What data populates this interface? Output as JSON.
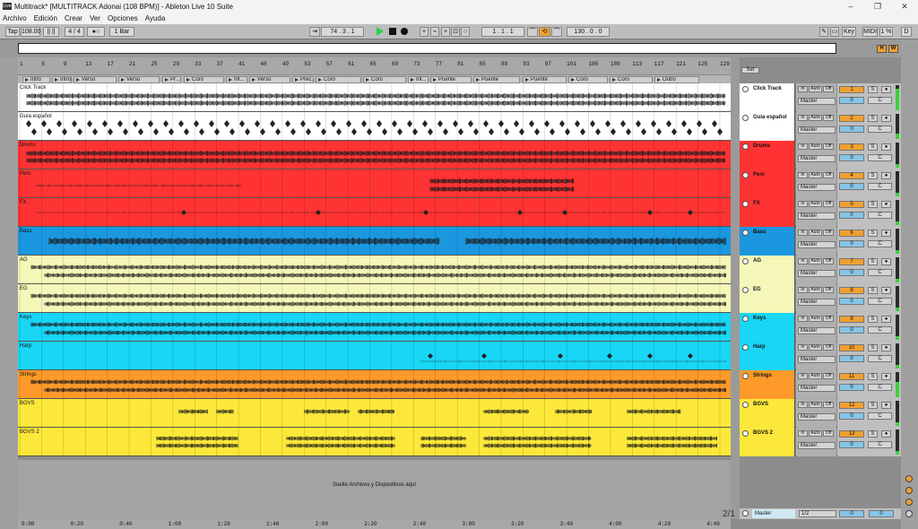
{
  "window": {
    "title": "Multitrack*  [MULTITRACK Adonai (108 BPM)] - Ableton Live 10 Suite",
    "app_icon": "Live"
  },
  "menu": [
    "Archivo",
    "Edición",
    "Crear",
    "Ver",
    "Opciones",
    "Ayuda"
  ],
  "control_bar": {
    "tap": "Tap",
    "tempo": "108.00",
    "nudge": "|| ||",
    "signature": "4 / 4",
    "metronome": "●○",
    "quantize": "1 Bar",
    "follow": "⇥",
    "position": "74 .   3 .   1",
    "loop_start": "1 .   1 .   1",
    "loop_length": "130 .   0 .   0",
    "key": "Key",
    "midi": "MIDI",
    "cpu": "1 %",
    "d": "D"
  },
  "overview": {
    "h_button": "H",
    "w_button": "W"
  },
  "ruler_bars": [
    "1",
    "5",
    "9",
    "13",
    "17",
    "21",
    "25",
    "29",
    "33",
    "37",
    "41",
    "45",
    "49",
    "53",
    "57",
    "61",
    "65",
    "69",
    "73",
    "77",
    "81",
    "85",
    "89",
    "93",
    "97",
    "101",
    "105",
    "109",
    "113",
    "117",
    "121",
    "125",
    "129"
  ],
  "locators": [
    "Intro",
    "Intro",
    "Verso",
    "Verso",
    "Pr...",
    "Coro",
    "Int...",
    "Verso",
    "Prec...",
    "Coro",
    "Coro",
    "Int...",
    "Puente",
    "Puente",
    "Puente",
    "Coro",
    "Coro",
    "Outro"
  ],
  "tracks": [
    {
      "name": "Click Track",
      "color": "#ffffff",
      "num": "1",
      "output": "Master",
      "vol": "0",
      "pattern": "dense"
    },
    {
      "name": "Guía español",
      "color": "#ffffff",
      "num": "2",
      "output": "Master",
      "vol": "0",
      "pattern": "spiky"
    },
    {
      "name": "Drums",
      "color": "#ff3333",
      "num": "3",
      "output": "Master",
      "vol": "0",
      "pattern": "dense"
    },
    {
      "name": "Perc",
      "color": "#ff3333",
      "num": "4",
      "output": "Master",
      "vol": "0",
      "pattern": "partial"
    },
    {
      "name": "FX",
      "color": "#ff3333",
      "num": "5",
      "output": "Master",
      "vol": "0",
      "pattern": "sparse"
    },
    {
      "name": "Bass",
      "color": "#1b97e0",
      "num": "6",
      "output": "Master",
      "vol": "0",
      "pattern": "wide"
    },
    {
      "name": "AG",
      "color": "#f4f7b8",
      "num": "7",
      "output": "Master",
      "vol": "0",
      "pattern": "double"
    },
    {
      "name": "EG",
      "color": "#f4f7b8",
      "num": "8",
      "output": "Master",
      "vol": "0",
      "pattern": "double"
    },
    {
      "name": "Keys",
      "color": "#19d6f5",
      "num": "9",
      "output": "Master",
      "vol": "0",
      "pattern": "double"
    },
    {
      "name": "Harp",
      "color": "#19d6f5",
      "num": "10",
      "output": "Master",
      "vol": "0",
      "pattern": "sparse2"
    },
    {
      "name": "Strings",
      "color": "#fd9a2a",
      "num": "11",
      "output": "Master",
      "vol": "0",
      "pattern": "double"
    },
    {
      "name": "BGVS",
      "color": "#fbe83a",
      "num": "12",
      "output": "Master",
      "vol": "0",
      "pattern": "blocks"
    },
    {
      "name": "BGVS 2",
      "color": "#fbe83a",
      "num": "13",
      "output": "Master",
      "vol": "0",
      "pattern": "blocks2"
    }
  ],
  "mixer_labels": {
    "in": "In",
    "auto": "Auto",
    "off": "Off",
    "solo": "S",
    "c": "C",
    "set": "Set"
  },
  "drop_message": "Suelte Archivos y Dispositivos aquí",
  "time_ruler": [
    "0:00",
    "0:20",
    "0:40",
    "1:00",
    "1:20",
    "1:40",
    "2:00",
    "2:20",
    "2:40",
    "3:00",
    "3:20",
    "3:40",
    "4:00",
    "4:20",
    "4:40"
  ],
  "master": {
    "name": "Master",
    "output": "1/2",
    "vol": "0",
    "vol2": "0"
  },
  "page_info": "2/1"
}
